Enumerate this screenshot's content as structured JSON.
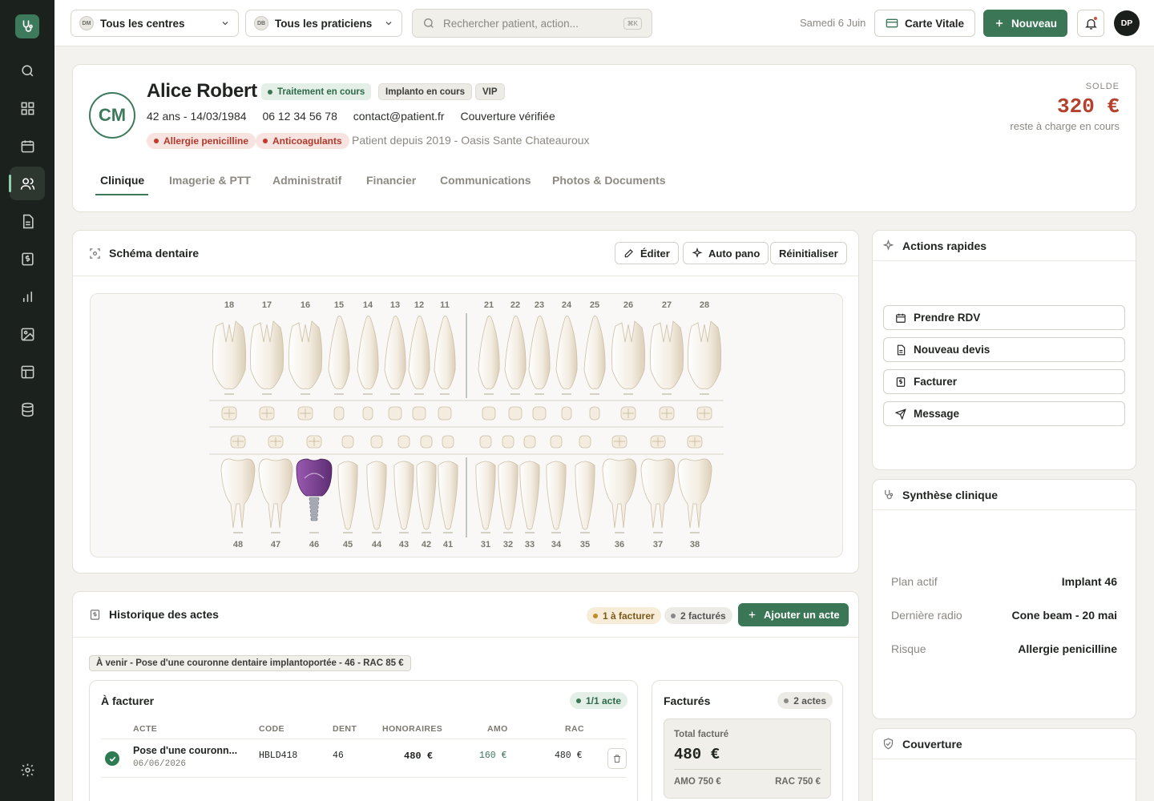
{
  "topbar": {
    "centers": "Tous les centres",
    "centers_initials": "DM",
    "practitioners": "Tous les praticiens",
    "practitioners_initials": "DB",
    "search_placeholder": "Rechercher patient, action...",
    "search_shortcut": "⌘K",
    "date": "Samedi 6 Juin",
    "carte_vitale": "Carte Vitale",
    "new": "Nouveau",
    "user_initials": "DP"
  },
  "patient": {
    "initials": "CM",
    "name": "Alice Robert",
    "tags": [
      "Traitement en cours",
      "Implanto en cours",
      "VIP"
    ],
    "age_dob": "42 ans - 14/03/1984",
    "phone": "06 12 34 56 78",
    "email": "contact@patient.fr",
    "coverage": "Couverture vérifiée",
    "alerts": [
      "Allergie penicilline",
      "Anticoagulants"
    ],
    "since": "Patient depuis 2019 - Oasis Sante Chateauroux",
    "balance_label": "SOLDE",
    "balance": "320 €",
    "balance_sub": "reste à charge en cours"
  },
  "tabs": [
    "Clinique",
    "Imagerie & PTT",
    "Administratif",
    "Financier",
    "Communications",
    "Photos & Documents"
  ],
  "dental": {
    "title": "Schéma dentaire",
    "edit": "Éditer",
    "auto": "Auto pano",
    "reset": "Réinitialiser",
    "upper": [
      "18",
      "17",
      "16",
      "15",
      "14",
      "13",
      "12",
      "11",
      "21",
      "22",
      "23",
      "24",
      "25",
      "26",
      "27",
      "28"
    ],
    "lower": [
      "48",
      "47",
      "46",
      "45",
      "44",
      "43",
      "42",
      "41",
      "31",
      "32",
      "33",
      "34",
      "35",
      "36",
      "37",
      "38"
    ],
    "implant_tooth": "46"
  },
  "history": {
    "title": "Historique des actes",
    "pending_badge": "1 à facturer",
    "billed_badge": "2 facturés",
    "add": "Ajouter un acte",
    "upcoming": "À venir - Pose d'une couronne dentaire implantoportée - 46 - RAC 85 €",
    "to_bill": {
      "title": "À facturer",
      "count": "1/1 acte",
      "headers": [
        "ACTE",
        "CODE",
        "DENT",
        "HONORAIRES",
        "AMO",
        "RAC"
      ],
      "rows": [
        {
          "act": "Pose d'une couronn...",
          "date": "06/06/2026",
          "code": "HBLD418",
          "tooth": "46",
          "fees": "480 €",
          "amo": "160 €",
          "rac": "480 €"
        }
      ]
    },
    "billed": {
      "title": "Facturés",
      "count": "2 actes",
      "total_label": "Total facturé",
      "total": "480 €",
      "amo": "AMO 750 €",
      "rac": "RAC 750 €"
    }
  },
  "quick": {
    "title": "Actions rapides",
    "items": [
      "Prendre RDV",
      "Nouveau devis",
      "Facturer",
      "Message"
    ]
  },
  "synth": {
    "title": "Synthèse clinique",
    "rows": [
      {
        "k": "Plan actif",
        "v": "Implant 46"
      },
      {
        "k": "Dernière radio",
        "v": "Cone beam - 20 mai"
      },
      {
        "k": "Risque",
        "v": "Allergie penicilline"
      }
    ]
  },
  "coverage": {
    "title": "Couverture"
  },
  "colors": {
    "brand": "#3b7656",
    "danger": "#b5402d",
    "implant": "#7a3f8a"
  }
}
